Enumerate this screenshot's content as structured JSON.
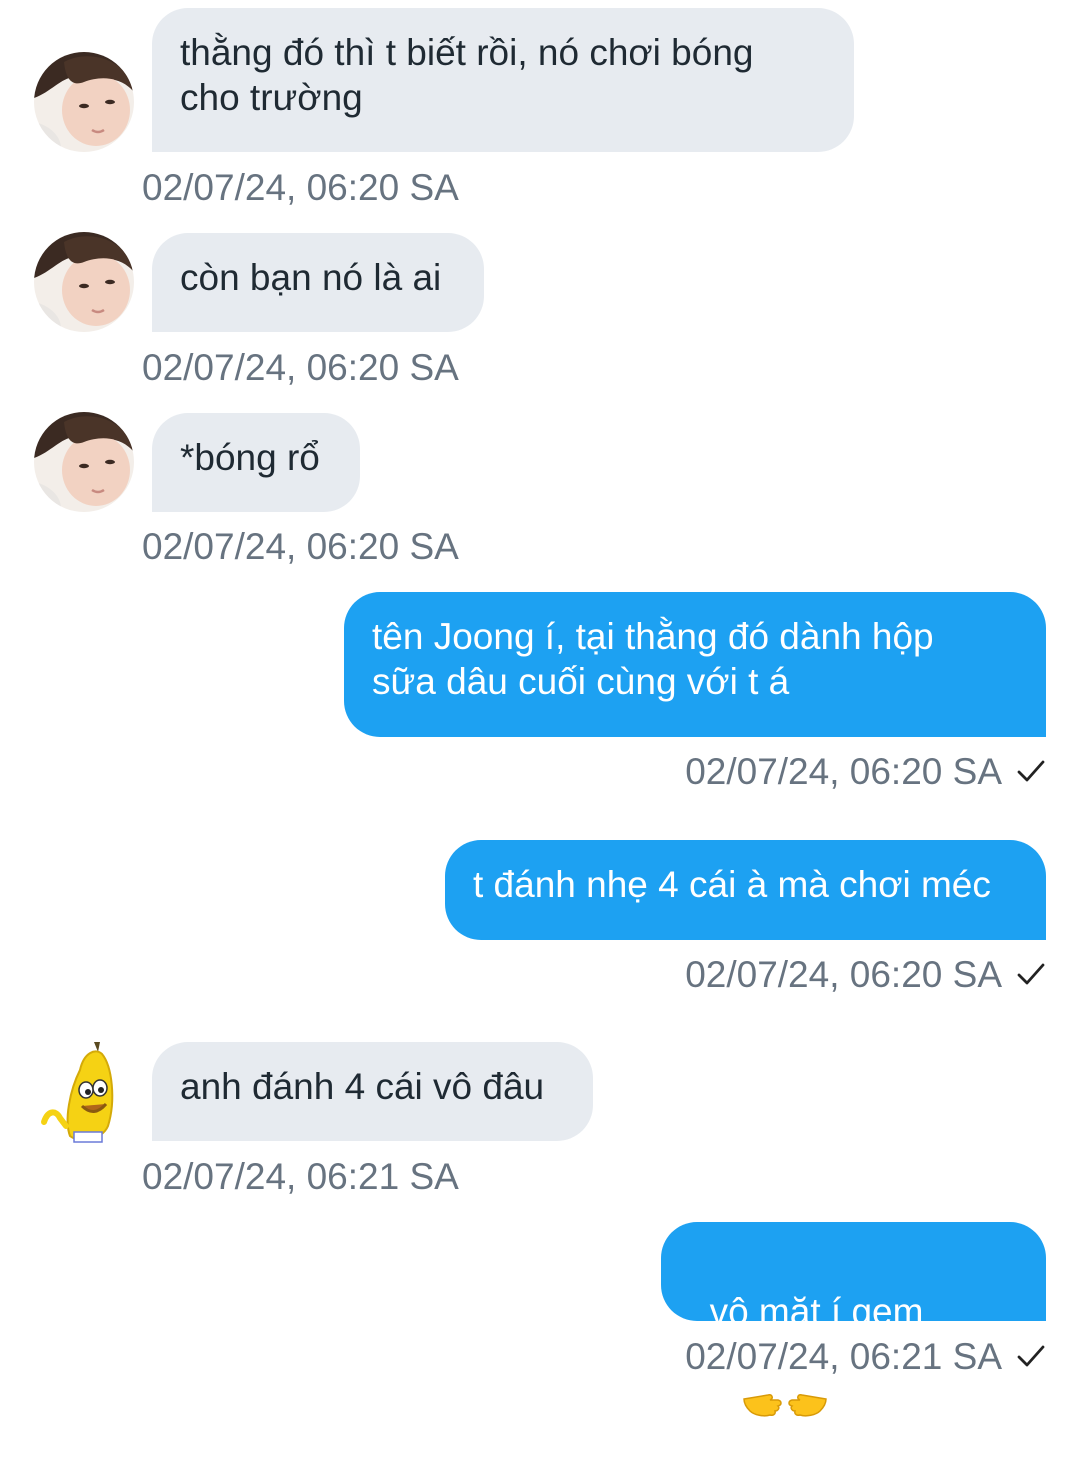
{
  "messages": [
    {
      "direction": "in",
      "avatar": "boy-avatar",
      "text": "thằng đó thì t biết rồi, nó chơi bóng\ncho trường",
      "time": "02/07/24, 06:20 SA"
    },
    {
      "direction": "in",
      "avatar": "boy-avatar",
      "text": "còn bạn nó là ai",
      "time": "02/07/24, 06:20 SA"
    },
    {
      "direction": "in",
      "avatar": "boy-avatar",
      "text": "*bóng rổ",
      "time": "02/07/24, 06:20 SA"
    },
    {
      "direction": "out",
      "text": "tên Joong í, tại thằng đó dành hộp\nsữa dâu cuối cùng với t á",
      "time": "02/07/24, 06:20 SA",
      "status_icon": "check-icon"
    },
    {
      "direction": "out",
      "text": "t đánh nhẹ 4 cái à mà chơi méc",
      "time": "02/07/24, 06:20 SA",
      "status_icon": "check-icon"
    },
    {
      "direction": "in",
      "avatar": "banana-avatar",
      "text": "anh đánh 4 cái vô đâu",
      "time": "02/07/24, 06:21 SA"
    },
    {
      "direction": "out",
      "text": "vô mặt í gem",
      "emoji": "pointing-hands-emoji",
      "time": "02/07/24, 06:21 SA",
      "status_icon": "check-icon"
    }
  ],
  "colors": {
    "incoming_bubble": "#e7ebf0",
    "outgoing_bubble": "#1da1f2",
    "timestamp": "#677380",
    "incoming_text": "#1f2a33"
  }
}
